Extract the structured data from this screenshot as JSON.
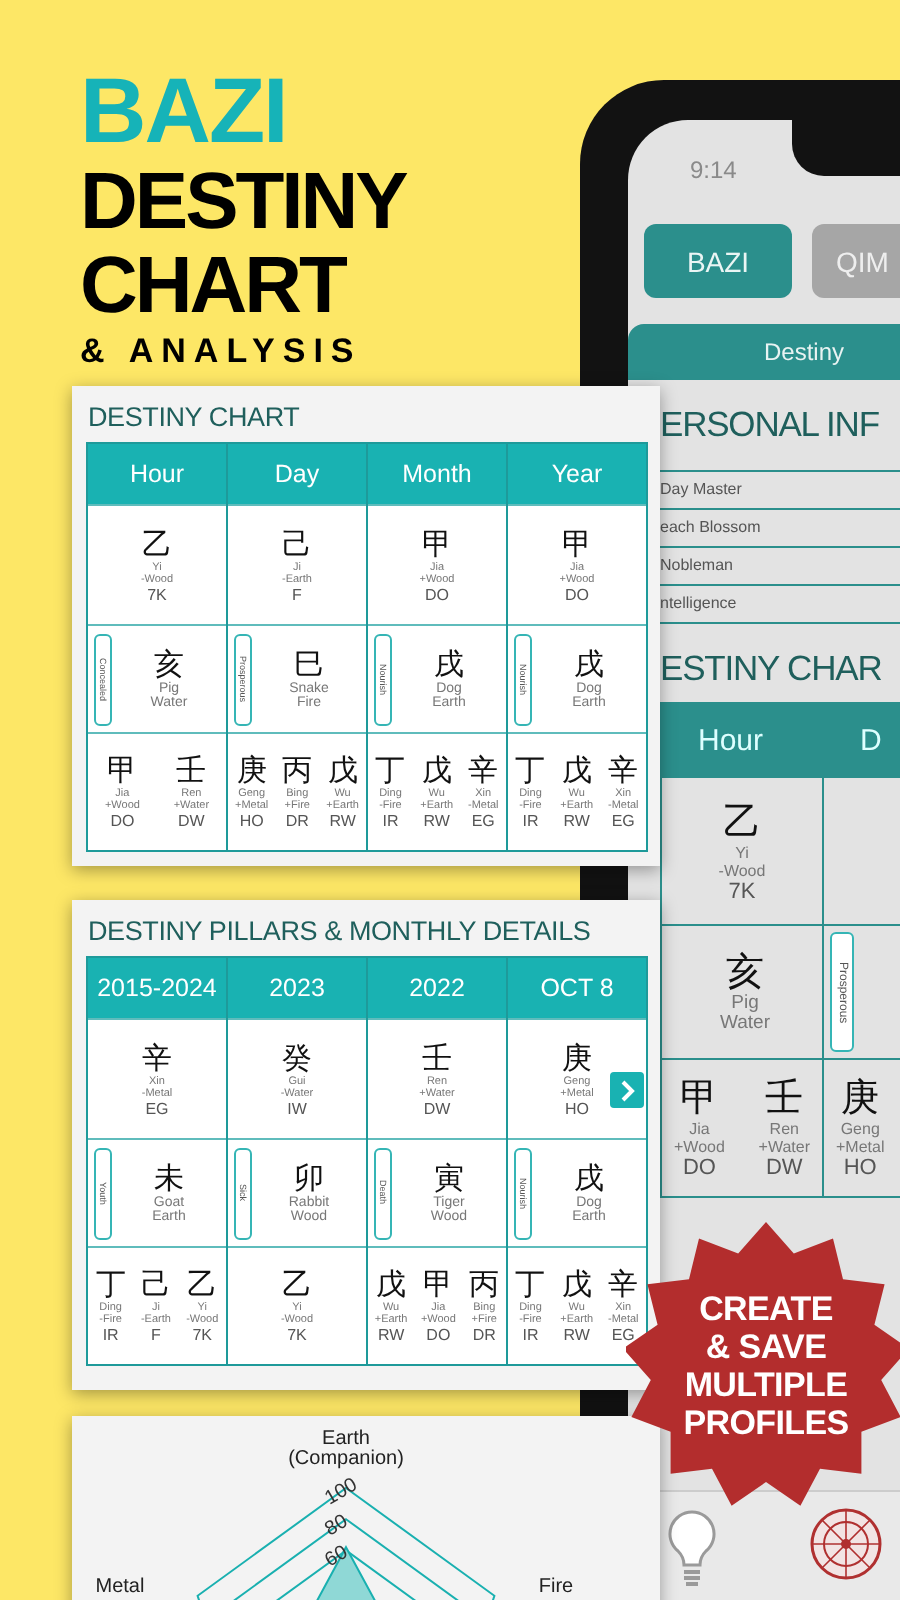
{
  "headline": {
    "line_1": "BAZI",
    "line_2": "DESTINY",
    "line_3": "CHART",
    "line_4": "& ANALYSIS"
  },
  "phone": {
    "time": "9:14",
    "tabs": [
      {
        "label": "BAZI",
        "selected": true
      },
      {
        "label": "QIM",
        "selected": false
      }
    ],
    "sub_tab": "Destiny",
    "section_1": "ERSONAL INF",
    "info_rows": [
      "Day Master",
      "each Blossom",
      "Nobleman",
      "ntelligence"
    ],
    "section_2": "ESTINY CHAR",
    "columns": [
      {
        "header": "Hour",
        "stem": {
          "char": "乙",
          "pinyin": "Yi",
          "element": "-Wood",
          "god": "7K"
        },
        "branch": {
          "char": "亥",
          "animal": "Pig",
          "element": "Water"
        },
        "hidden": [
          {
            "char": "甲",
            "pinyin": "Jia",
            "element": "+Wood",
            "god": "DO"
          },
          {
            "char": "壬",
            "pinyin": "Ren",
            "element": "+Water",
            "god": "DW"
          }
        ]
      },
      {
        "header": "D",
        "branch": {
          "tag": "Prosperous"
        },
        "hidden": [
          {
            "char": "庚",
            "pinyin": "Geng",
            "element": "+Metal",
            "god": "HO"
          }
        ]
      }
    ]
  },
  "cards": [
    {
      "kind": "pillars",
      "title": "DESTINY CHART",
      "next_button": false,
      "columns": [
        {
          "header": "Hour",
          "stem": {
            "char": "乙",
            "pinyin": "Yi",
            "element": "-Wood",
            "god": "7K"
          },
          "branch": {
            "tag": "Concealed",
            "char": "亥",
            "animal": "Pig",
            "element": "Water"
          },
          "hidden": [
            {
              "char": "甲",
              "pinyin": "Jia",
              "element": "+Wood",
              "god": "DO"
            },
            {
              "char": "壬",
              "pinyin": "Ren",
              "element": "+Water",
              "god": "DW"
            }
          ]
        },
        {
          "header": "Day",
          "stem": {
            "char": "己",
            "pinyin": "Ji",
            "element": "-Earth",
            "god": "F"
          },
          "branch": {
            "tag": "Prosperous",
            "char": "巳",
            "animal": "Snake",
            "element": "Fire"
          },
          "hidden": [
            {
              "char": "庚",
              "pinyin": "Geng",
              "element": "+Metal",
              "god": "HO"
            },
            {
              "char": "丙",
              "pinyin": "Bing",
              "element": "+Fire",
              "god": "DR"
            },
            {
              "char": "戊",
              "pinyin": "Wu",
              "element": "+Earth",
              "god": "RW"
            }
          ]
        },
        {
          "header": "Month",
          "stem": {
            "char": "甲",
            "pinyin": "Jia",
            "element": "+Wood",
            "god": "DO"
          },
          "branch": {
            "tag": "Nourish",
            "char": "戌",
            "animal": "Dog",
            "element": "Earth"
          },
          "hidden": [
            {
              "char": "丁",
              "pinyin": "Ding",
              "element": "-Fire",
              "god": "IR"
            },
            {
              "char": "戊",
              "pinyin": "Wu",
              "element": "+Earth",
              "god": "RW"
            },
            {
              "char": "辛",
              "pinyin": "Xin",
              "element": "-Metal",
              "god": "EG"
            }
          ]
        },
        {
          "header": "Year",
          "stem": {
            "char": "甲",
            "pinyin": "Jia",
            "element": "+Wood",
            "god": "DO"
          },
          "branch": {
            "tag": "Nourish",
            "char": "戌",
            "animal": "Dog",
            "element": "Earth"
          },
          "hidden": [
            {
              "char": "丁",
              "pinyin": "Ding",
              "element": "-Fire",
              "god": "IR"
            },
            {
              "char": "戊",
              "pinyin": "Wu",
              "element": "+Earth",
              "god": "RW"
            },
            {
              "char": "辛",
              "pinyin": "Xin",
              "element": "-Metal",
              "god": "EG"
            }
          ]
        }
      ]
    },
    {
      "kind": "pillars",
      "title": "DESTINY PILLARS & MONTHLY DETAILS",
      "next_button": true,
      "columns": [
        {
          "header": "2015-2024",
          "stem": {
            "char": "辛",
            "pinyin": "Xin",
            "element": "-Metal",
            "god": "EG"
          },
          "branch": {
            "tag": "Youth",
            "char": "未",
            "animal": "Goat",
            "element": "Earth"
          },
          "hidden": [
            {
              "char": "丁",
              "pinyin": "Ding",
              "element": "-Fire",
              "god": "IR"
            },
            {
              "char": "己",
              "pinyin": "Ji",
              "element": "-Earth",
              "god": "F"
            },
            {
              "char": "乙",
              "pinyin": "Yi",
              "element": "-Wood",
              "god": "7K"
            }
          ]
        },
        {
          "header": "2023",
          "stem": {
            "char": "癸",
            "pinyin": "Gui",
            "element": "-Water",
            "god": "IW"
          },
          "branch": {
            "tag": "Sick",
            "char": "卯",
            "animal": "Rabbit",
            "element": "Wood"
          },
          "hidden": [
            {
              "char": "乙",
              "pinyin": "Yi",
              "element": "-Wood",
              "god": "7K"
            }
          ]
        },
        {
          "header": "2022",
          "stem": {
            "char": "壬",
            "pinyin": "Ren",
            "element": "+Water",
            "god": "DW"
          },
          "branch": {
            "tag": "Death",
            "char": "寅",
            "animal": "Tiger",
            "element": "Wood"
          },
          "hidden": [
            {
              "char": "戊",
              "pinyin": "Wu",
              "element": "+Earth",
              "god": "RW"
            },
            {
              "char": "甲",
              "pinyin": "Jia",
              "element": "+Wood",
              "god": "DO"
            },
            {
              "char": "丙",
              "pinyin": "Bing",
              "element": "+Fire",
              "god": "DR"
            }
          ]
        },
        {
          "header": "OCT 8",
          "stem": {
            "char": "庚",
            "pinyin": "Geng",
            "element": "+Metal",
            "god": "HO"
          },
          "branch": {
            "tag": "Nourish",
            "char": "戌",
            "animal": "Dog",
            "element": "Earth"
          },
          "hidden": [
            {
              "char": "丁",
              "pinyin": "Ding",
              "element": "-Fire",
              "god": "IR"
            },
            {
              "char": "戊",
              "pinyin": "Wu",
              "element": "+Earth",
              "god": "RW"
            },
            {
              "char": "辛",
              "pinyin": "Xin",
              "element": "-Metal",
              "god": "EG"
            }
          ]
        }
      ]
    },
    {
      "kind": "radar",
      "axis_top": [
        "Earth",
        "(Companion)"
      ],
      "axis_left": "Metal",
      "axis_right": "Fire",
      "ticks": [
        "100",
        "80",
        "60"
      ]
    }
  ],
  "badge": [
    "CREATE",
    "& SAVE",
    "MULTIPLE",
    "PROFILES"
  ]
}
